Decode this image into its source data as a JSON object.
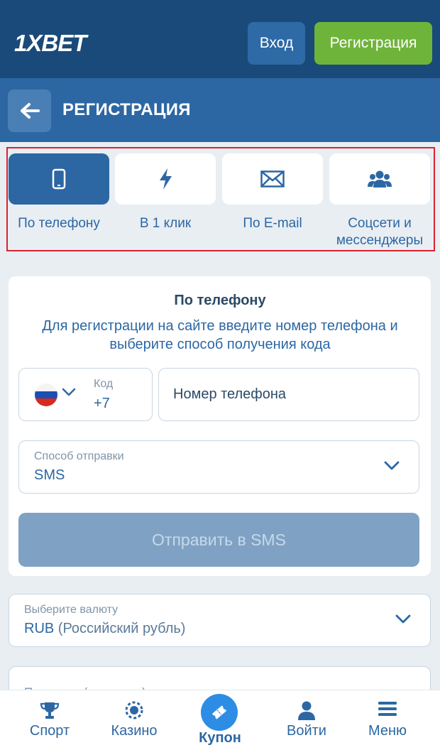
{
  "header": {
    "logo_primary": "1X",
    "logo_secondary": "BET",
    "login_label": "Вход",
    "register_label": "Регистрация"
  },
  "titlebar": {
    "title": "РЕГИСТРАЦИЯ",
    "back_icon": "arrow-left-icon"
  },
  "methods": [
    {
      "label": "По телефону",
      "icon": "phone-icon",
      "active": true
    },
    {
      "label": "В 1 клик",
      "icon": "lightning-icon",
      "active": false
    },
    {
      "label": "По E-mail",
      "icon": "envelope-icon",
      "active": false
    },
    {
      "label": "Соцсети и мессенджеры",
      "icon": "users-icon",
      "active": false
    }
  ],
  "phone_form": {
    "title": "По телефону",
    "description": "Для регистрации на сайте введите номер телефона и выберите способ получения кода",
    "code_label": "Код",
    "code_value": "+7",
    "phone_placeholder": "Номер телефона",
    "method_label": "Способ отправки",
    "method_value": "SMS",
    "send_label": "Отправить в SMS"
  },
  "currency": {
    "label": "Выберите валюту",
    "code": "RUB",
    "name": "(Российский рубль)"
  },
  "next_field_partial": "Промокод (если есть)",
  "bottom_nav": [
    {
      "label": "Спорт",
      "icon": "trophy-icon"
    },
    {
      "label": "Казино",
      "icon": "casino-chip-icon"
    },
    {
      "label": "Купон",
      "icon": "ticket-icon"
    },
    {
      "label": "Войти",
      "icon": "user-icon"
    },
    {
      "label": "Меню",
      "icon": "hamburger-icon"
    }
  ],
  "colors": {
    "header_bg": "#1a4a79",
    "titlebar_bg": "#2c67a3",
    "register_green": "#6fb43a",
    "accent_blue": "#2c67a3",
    "highlight_frame": "#d9232f"
  }
}
